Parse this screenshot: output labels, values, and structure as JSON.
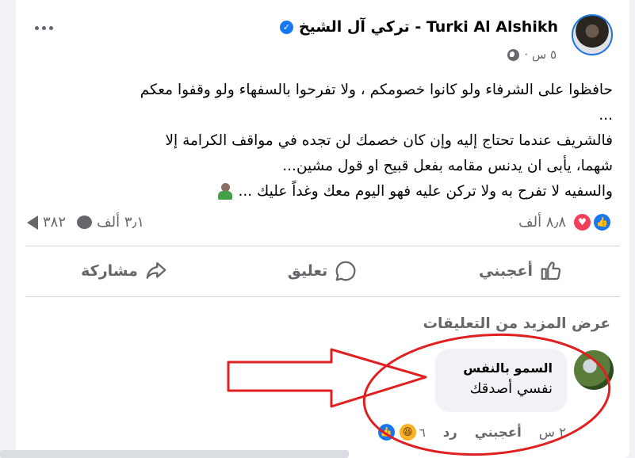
{
  "post": {
    "author": "تركي آل الشيخ - Turki Al Alshikh",
    "time": "٥ س ·",
    "text_lines": [
      "حافظوا على الشرفاء ولو كانوا خصومكم ، ولا تفرحوا بالسفهاء ولو وقفوا معكم",
      "...",
      "فالشريف عندما تحتاج إليه وإن كان خصمك لن تجده في مواقف الكرامة إلا",
      "شهما، يأبى ان يدنس مقامه بفعل قبيح او قول مشين...",
      "والسفيه لا تفرح به ولا تركن عليه فهو اليوم معك وغداً عليك ..."
    ],
    "reactions_count": "٨٫٨ ألف",
    "comments_count": "٣٫١ ألف",
    "shares_count": "٣٨٢"
  },
  "actions": {
    "like": "أعجبني",
    "comment": "تعليق",
    "share": "مشاركة"
  },
  "comments": {
    "view_more": "عرض المزيد من التعليقات",
    "items": [
      {
        "name": "السمو بالنفس",
        "text": "نفسي أصدقك",
        "time": "٢ س",
        "like": "أعجبني",
        "reply": "رد",
        "reactions_count": "٦"
      }
    ]
  },
  "colors": {
    "accent": "#1877f2",
    "annotation": "#e02020",
    "muted_text": "#65676b"
  }
}
